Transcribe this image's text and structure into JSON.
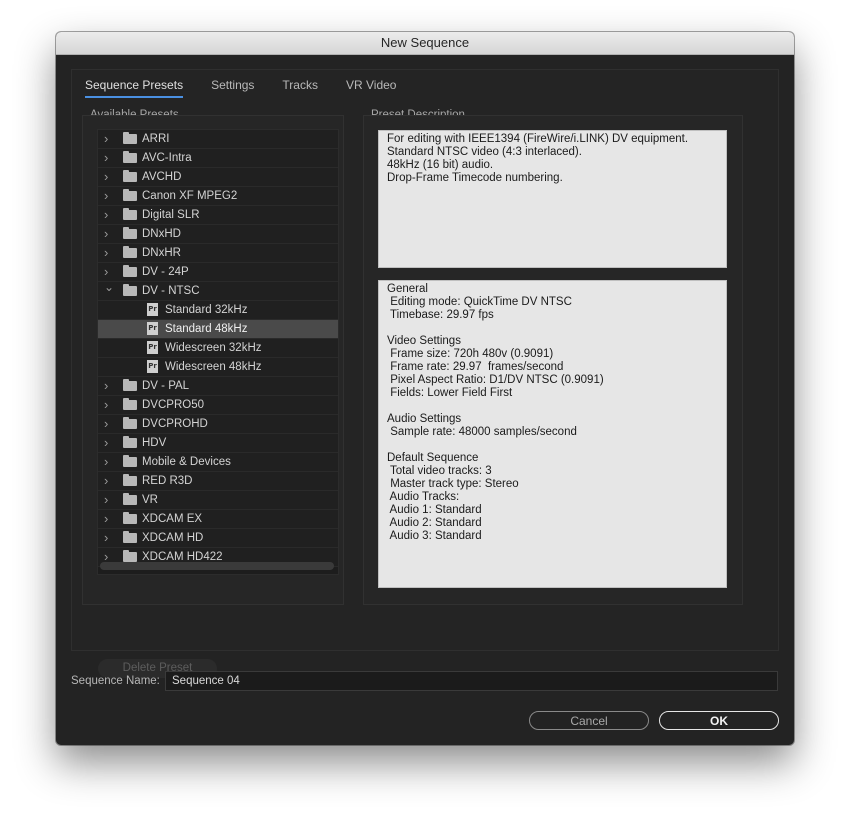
{
  "window": {
    "title": "New Sequence"
  },
  "tabs": [
    {
      "label": "Sequence Presets",
      "active": true
    },
    {
      "label": "Settings",
      "active": false
    },
    {
      "label": "Tracks",
      "active": false
    },
    {
      "label": "VR Video",
      "active": false
    }
  ],
  "presets": {
    "label": "Available Presets",
    "folders": [
      {
        "label": "ARRI",
        "expanded": false
      },
      {
        "label": "AVC-Intra",
        "expanded": false
      },
      {
        "label": "AVCHD",
        "expanded": false
      },
      {
        "label": "Canon XF MPEG2",
        "expanded": false
      },
      {
        "label": "Digital SLR",
        "expanded": false
      },
      {
        "label": "DNxHD",
        "expanded": false
      },
      {
        "label": "DNxHR",
        "expanded": false
      },
      {
        "label": "DV - 24P",
        "expanded": false
      },
      {
        "label": "DV - NTSC",
        "expanded": true,
        "children": [
          {
            "label": "Standard 32kHz",
            "selected": false
          },
          {
            "label": "Standard 48kHz",
            "selected": true
          },
          {
            "label": "Widescreen 32kHz",
            "selected": false
          },
          {
            "label": "Widescreen 48kHz",
            "selected": false
          }
        ]
      },
      {
        "label": "DV - PAL",
        "expanded": false
      },
      {
        "label": "DVCPRO50",
        "expanded": false
      },
      {
        "label": "DVCPROHD",
        "expanded": false
      },
      {
        "label": "HDV",
        "expanded": false
      },
      {
        "label": "Mobile & Devices",
        "expanded": false
      },
      {
        "label": "RED R3D",
        "expanded": false
      },
      {
        "label": "VR",
        "expanded": false
      },
      {
        "label": "XDCAM EX",
        "expanded": false
      },
      {
        "label": "XDCAM HD",
        "expanded": false
      },
      {
        "label": "XDCAM HD422",
        "expanded": false
      }
    ]
  },
  "description": {
    "label": "Preset Description",
    "summary": "For editing with IEEE1394 (FireWire/i.LINK) DV equipment.\nStandard NTSC video (4:3 interlaced).\n48kHz (16 bit) audio.\nDrop-Frame Timecode numbering.",
    "details": "General\n Editing mode: QuickTime DV NTSC\n Timebase: 29.97 fps\n\nVideo Settings\n Frame size: 720h 480v (0.9091)\n Frame rate: 29.97  frames/second\n Pixel Aspect Ratio: D1/DV NTSC (0.9091)\n Fields: Lower Field First\n\nAudio Settings\n Sample rate: 48000 samples/second\n\nDefault Sequence\n Total video tracks: 3\n Master track type: Stereo\n Audio Tracks:\n Audio 1: Standard\n Audio 2: Standard\n Audio 3: Standard"
  },
  "actions": {
    "delete_label": "Delete Preset",
    "cancel_label": "Cancel",
    "ok_label": "OK"
  },
  "sequence_name": {
    "label": "Sequence Name:",
    "value": "Sequence 04"
  },
  "icons": {
    "collapsed": "chevron-right-icon",
    "expanded": "chevron-down-icon",
    "folder": "folder-icon",
    "preset_file": "premiere-preset-icon"
  }
}
